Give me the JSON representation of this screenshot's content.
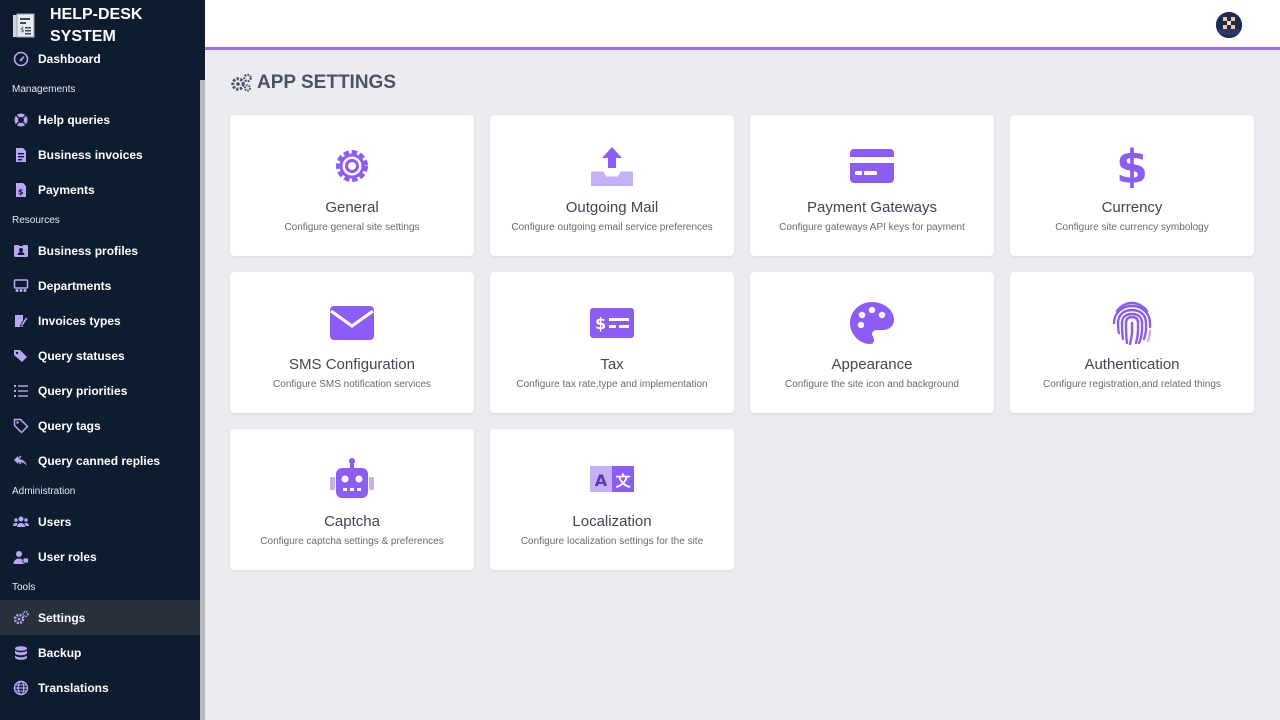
{
  "app": {
    "name": "HELP-DESK SYSTEM"
  },
  "sidebar": {
    "sections": [
      {
        "items": [
          {
            "label": "Dashboard",
            "icon": "gauge-icon"
          }
        ]
      },
      {
        "label": "Managements",
        "items": [
          {
            "label": "Help queries",
            "icon": "lifebuoy-icon"
          },
          {
            "label": "Business invoices",
            "icon": "invoice-icon"
          },
          {
            "label": "Payments",
            "icon": "receipt-icon"
          }
        ]
      },
      {
        "label": "Resources",
        "items": [
          {
            "label": "Business profiles",
            "icon": "id-card-icon"
          },
          {
            "label": "Departments",
            "icon": "departments-icon"
          },
          {
            "label": "Invoices types",
            "icon": "edit-document-icon"
          },
          {
            "label": "Query statuses",
            "icon": "tags-icon"
          },
          {
            "label": "Query priorities",
            "icon": "list-icon"
          },
          {
            "label": "Query tags",
            "icon": "tag-icon"
          },
          {
            "label": "Query canned replies",
            "icon": "reply-all-icon"
          }
        ]
      },
      {
        "label": "Administration",
        "items": [
          {
            "label": "Users",
            "icon": "users-icon"
          },
          {
            "label": "User roles",
            "icon": "user-role-icon"
          }
        ]
      },
      {
        "label": "Tools",
        "items": [
          {
            "label": "Settings",
            "icon": "gears-icon",
            "active": true
          },
          {
            "label": "Backup",
            "icon": "database-icon"
          },
          {
            "label": "Translations",
            "icon": "globe-icon"
          }
        ]
      }
    ]
  },
  "page": {
    "title": "APP SETTINGS"
  },
  "cards": [
    {
      "title": "General",
      "description": "Configure general site settings",
      "icon": "gear-icon"
    },
    {
      "title": "Outgoing Mail",
      "description": "Configure outgoing email service preferences",
      "icon": "outbox-upload-icon"
    },
    {
      "title": "Payment Gateways",
      "description": "Configure gateways API keys for payment",
      "icon": "credit-card-icon"
    },
    {
      "title": "Currency",
      "description": "Configure site currency symbology",
      "icon": "dollar-sign-icon"
    },
    {
      "title": "SMS Configuration",
      "description": "Configure SMS notification services",
      "icon": "envelope-icon"
    },
    {
      "title": "Tax",
      "description": "Configure tax rate,type and implementation",
      "icon": "money-check-icon"
    },
    {
      "title": "Appearance",
      "description": "Configure the site icon and background",
      "icon": "palette-icon"
    },
    {
      "title": "Authentication",
      "description": "Configure registration,and related things",
      "icon": "fingerprint-icon"
    },
    {
      "title": "Captcha",
      "description": "Configure captcha settings & preferences",
      "icon": "robot-icon"
    },
    {
      "title": "Localization",
      "description": "Configure localization settings for the site",
      "icon": "language-icon"
    }
  ],
  "colors": {
    "accent": "#9e6cf0",
    "sidebar_bg": "#0e1c30",
    "sidebar_active": "#28303c",
    "icon_purple": "#8b5cf6",
    "nav_icon": "#b9a6f5"
  }
}
